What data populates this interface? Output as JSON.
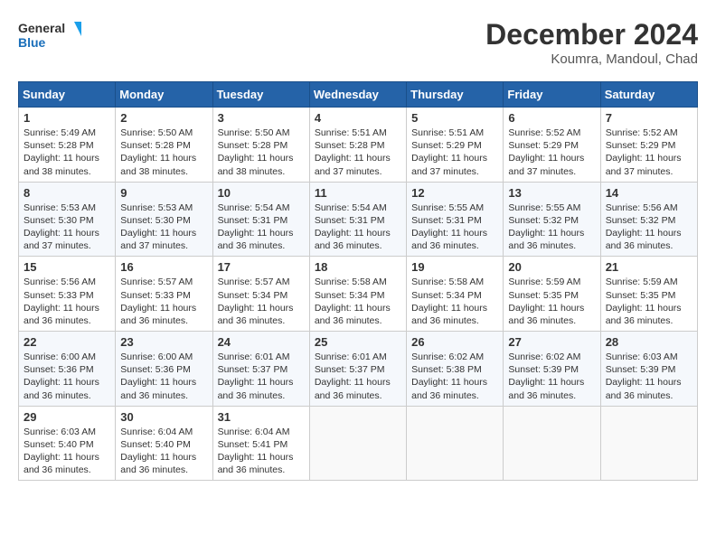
{
  "header": {
    "logo_general": "General",
    "logo_blue": "Blue",
    "month": "December 2024",
    "location": "Koumra, Mandoul, Chad"
  },
  "days_of_week": [
    "Sunday",
    "Monday",
    "Tuesday",
    "Wednesday",
    "Thursday",
    "Friday",
    "Saturday"
  ],
  "weeks": [
    [
      {
        "day": "1",
        "info": "Sunrise: 5:49 AM\nSunset: 5:28 PM\nDaylight: 11 hours\nand 38 minutes."
      },
      {
        "day": "2",
        "info": "Sunrise: 5:50 AM\nSunset: 5:28 PM\nDaylight: 11 hours\nand 38 minutes."
      },
      {
        "day": "3",
        "info": "Sunrise: 5:50 AM\nSunset: 5:28 PM\nDaylight: 11 hours\nand 38 minutes."
      },
      {
        "day": "4",
        "info": "Sunrise: 5:51 AM\nSunset: 5:28 PM\nDaylight: 11 hours\nand 37 minutes."
      },
      {
        "day": "5",
        "info": "Sunrise: 5:51 AM\nSunset: 5:29 PM\nDaylight: 11 hours\nand 37 minutes."
      },
      {
        "day": "6",
        "info": "Sunrise: 5:52 AM\nSunset: 5:29 PM\nDaylight: 11 hours\nand 37 minutes."
      },
      {
        "day": "7",
        "info": "Sunrise: 5:52 AM\nSunset: 5:29 PM\nDaylight: 11 hours\nand 37 minutes."
      }
    ],
    [
      {
        "day": "8",
        "info": "Sunrise: 5:53 AM\nSunset: 5:30 PM\nDaylight: 11 hours\nand 37 minutes."
      },
      {
        "day": "9",
        "info": "Sunrise: 5:53 AM\nSunset: 5:30 PM\nDaylight: 11 hours\nand 37 minutes."
      },
      {
        "day": "10",
        "info": "Sunrise: 5:54 AM\nSunset: 5:31 PM\nDaylight: 11 hours\nand 36 minutes."
      },
      {
        "day": "11",
        "info": "Sunrise: 5:54 AM\nSunset: 5:31 PM\nDaylight: 11 hours\nand 36 minutes."
      },
      {
        "day": "12",
        "info": "Sunrise: 5:55 AM\nSunset: 5:31 PM\nDaylight: 11 hours\nand 36 minutes."
      },
      {
        "day": "13",
        "info": "Sunrise: 5:55 AM\nSunset: 5:32 PM\nDaylight: 11 hours\nand 36 minutes."
      },
      {
        "day": "14",
        "info": "Sunrise: 5:56 AM\nSunset: 5:32 PM\nDaylight: 11 hours\nand 36 minutes."
      }
    ],
    [
      {
        "day": "15",
        "info": "Sunrise: 5:56 AM\nSunset: 5:33 PM\nDaylight: 11 hours\nand 36 minutes."
      },
      {
        "day": "16",
        "info": "Sunrise: 5:57 AM\nSunset: 5:33 PM\nDaylight: 11 hours\nand 36 minutes."
      },
      {
        "day": "17",
        "info": "Sunrise: 5:57 AM\nSunset: 5:34 PM\nDaylight: 11 hours\nand 36 minutes."
      },
      {
        "day": "18",
        "info": "Sunrise: 5:58 AM\nSunset: 5:34 PM\nDaylight: 11 hours\nand 36 minutes."
      },
      {
        "day": "19",
        "info": "Sunrise: 5:58 AM\nSunset: 5:34 PM\nDaylight: 11 hours\nand 36 minutes."
      },
      {
        "day": "20",
        "info": "Sunrise: 5:59 AM\nSunset: 5:35 PM\nDaylight: 11 hours\nand 36 minutes."
      },
      {
        "day": "21",
        "info": "Sunrise: 5:59 AM\nSunset: 5:35 PM\nDaylight: 11 hours\nand 36 minutes."
      }
    ],
    [
      {
        "day": "22",
        "info": "Sunrise: 6:00 AM\nSunset: 5:36 PM\nDaylight: 11 hours\nand 36 minutes."
      },
      {
        "day": "23",
        "info": "Sunrise: 6:00 AM\nSunset: 5:36 PM\nDaylight: 11 hours\nand 36 minutes."
      },
      {
        "day": "24",
        "info": "Sunrise: 6:01 AM\nSunset: 5:37 PM\nDaylight: 11 hours\nand 36 minutes."
      },
      {
        "day": "25",
        "info": "Sunrise: 6:01 AM\nSunset: 5:37 PM\nDaylight: 11 hours\nand 36 minutes."
      },
      {
        "day": "26",
        "info": "Sunrise: 6:02 AM\nSunset: 5:38 PM\nDaylight: 11 hours\nand 36 minutes."
      },
      {
        "day": "27",
        "info": "Sunrise: 6:02 AM\nSunset: 5:39 PM\nDaylight: 11 hours\nand 36 minutes."
      },
      {
        "day": "28",
        "info": "Sunrise: 6:03 AM\nSunset: 5:39 PM\nDaylight: 11 hours\nand 36 minutes."
      }
    ],
    [
      {
        "day": "29",
        "info": "Sunrise: 6:03 AM\nSunset: 5:40 PM\nDaylight: 11 hours\nand 36 minutes."
      },
      {
        "day": "30",
        "info": "Sunrise: 6:04 AM\nSunset: 5:40 PM\nDaylight: 11 hours\nand 36 minutes."
      },
      {
        "day": "31",
        "info": "Sunrise: 6:04 AM\nSunset: 5:41 PM\nDaylight: 11 hours\nand 36 minutes."
      },
      {
        "day": "",
        "info": ""
      },
      {
        "day": "",
        "info": ""
      },
      {
        "day": "",
        "info": ""
      },
      {
        "day": "",
        "info": ""
      }
    ]
  ]
}
